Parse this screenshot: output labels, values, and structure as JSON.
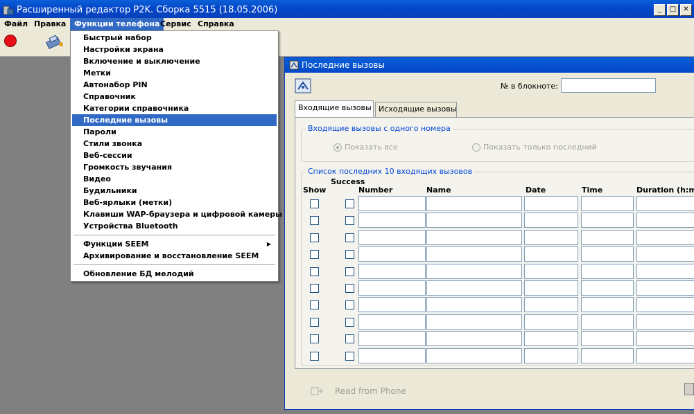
{
  "window": {
    "title": "Расширенный редактор P2K. Сборка 5515 (18.05.2006)"
  },
  "menubar": {
    "items": [
      {
        "label": "Файл"
      },
      {
        "label": "Правка"
      },
      {
        "label": "Функции телефона"
      },
      {
        "label": "Сервис"
      },
      {
        "label": "Справка"
      }
    ]
  },
  "dropdown": {
    "items": [
      "Быстрый набор",
      "Настройки экрана",
      "Включение и выключение",
      "Метки",
      "Автонабор PIN",
      "Справочник",
      "Категории справочника",
      "Последние вызовы",
      "Пароли",
      "Стили звонка",
      "Веб-сессии",
      "Громкость звучания",
      "Видео",
      "Будильники",
      "Веб-ярлыки (метки)",
      "Клавиши WAP-браузера и цифровой камеры",
      "Устройства Bluetooth"
    ],
    "selected": "Последние вызовы",
    "items2": [
      "Функции SEEM",
      "Архивирование и восстановление SEEM"
    ],
    "items3": [
      "Обновление БД мелодий"
    ]
  },
  "child": {
    "title": "Последние вызовы",
    "notebook_label": "№ в блокноте:",
    "notebook_value": "",
    "tabs": [
      "Входящие вызовы",
      "Исходящие вызовы"
    ],
    "group1": {
      "label": "Входящие вызовы с одного номера",
      "radio_all": "Показать все",
      "radio_last": "Показать только последний"
    },
    "group2": {
      "label": "Список последних 10 входящих вызовов",
      "columns": {
        "show": "Show",
        "success": "Success",
        "number": "Number",
        "name": "Name",
        "date": "Date",
        "time": "Time",
        "duration": "Duration (h:m"
      }
    },
    "read_button": "Read from Phone"
  }
}
